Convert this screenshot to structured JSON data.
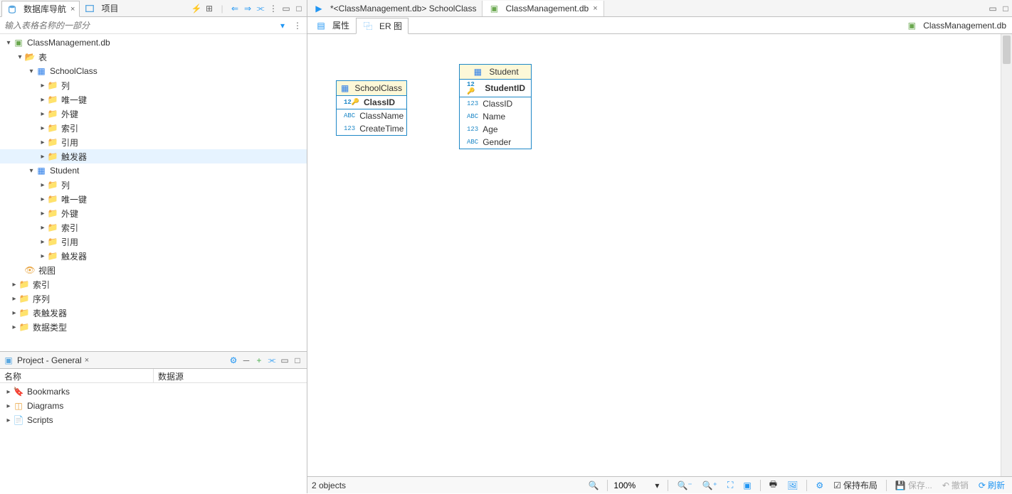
{
  "leftTabs": {
    "dbNav": "数据库导航",
    "project": "项目"
  },
  "filter": {
    "placeholder": "输入表格名称的一部分"
  },
  "tree": {
    "db": "ClassManagement.db",
    "tables": "表",
    "schoolClass": "SchoolClass",
    "student": "Student",
    "col": "列",
    "uniqueKey": "唯一键",
    "fk": "外键",
    "index": "索引",
    "ref": "引用",
    "trigger": "触发器",
    "views": "视图",
    "indexes": "索引",
    "sequences": "序列",
    "tableTriggers": "表触发器",
    "dataTypes": "数据类型"
  },
  "projectPanel": {
    "title": "Project - General",
    "colName": "名称",
    "colSource": "数据源",
    "bookmarks": "Bookmarks",
    "diagrams": "Diagrams",
    "scripts": "Scripts"
  },
  "editorTabs": {
    "tab1": "*<ClassManagement.db> SchoolClass",
    "tab2": "ClassManagement.db"
  },
  "subTabs": {
    "props": "属性",
    "er": "ER 图"
  },
  "breadcrumb": "ClassManagement.db",
  "er": {
    "schoolClass": {
      "title": "SchoolClass",
      "pk": "ClassID",
      "c2": "ClassName",
      "c3": "CreateTime"
    },
    "student": {
      "title": "Student",
      "pk": "StudentID",
      "c2": "ClassID",
      "c3": "Name",
      "c4": "Age",
      "c5": "Gender"
    }
  },
  "status": {
    "objects": "2 objects",
    "zoom": "100%",
    "keepLayout": "保持布局",
    "save": "保存...",
    "revert": "撤销",
    "refresh": "刷新"
  }
}
